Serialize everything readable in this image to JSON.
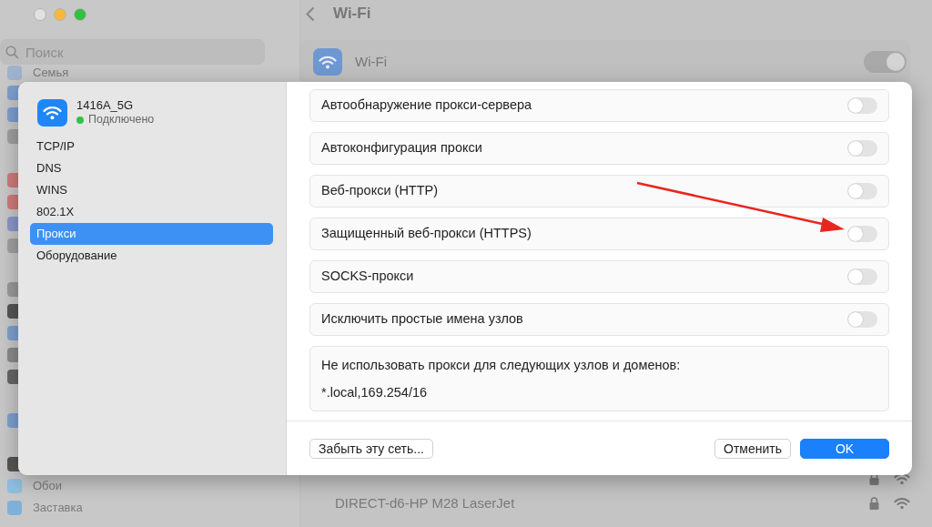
{
  "sidebar": {
    "search": {
      "placeholder": "Поиск"
    },
    "items": [
      {
        "label": "Семья"
      },
      {
        "label": "Обои"
      },
      {
        "label": "Заставка"
      }
    ]
  },
  "main": {
    "title": "Wi-Fi",
    "wifi": {
      "label": "Wi-Fi",
      "on": true
    },
    "networks": [
      {
        "name": "DIRECT-d6-HP M28 LaserJet",
        "locked": true
      }
    ]
  },
  "dialog": {
    "network": {
      "name": "1416A_5G",
      "status": "Подключено",
      "connected": true
    },
    "nav": [
      {
        "label": "TCP/IP",
        "selected": false
      },
      {
        "label": "DNS",
        "selected": false
      },
      {
        "label": "WINS",
        "selected": false
      },
      {
        "label": "802.1X",
        "selected": false
      },
      {
        "label": "Прокси",
        "selected": true
      },
      {
        "label": "Оборудование",
        "selected": false
      }
    ],
    "proxies": [
      {
        "label": "Автообнаружение прокси-сервера",
        "on": false
      },
      {
        "label": "Автоконфигурация прокси",
        "on": false
      },
      {
        "label": "Веб-прокси (HTTP)",
        "on": false
      },
      {
        "label": "Защищенный веб-прокси (HTTPS)",
        "on": false
      },
      {
        "label": "SOCKS-прокси",
        "on": false
      },
      {
        "label": "Исключить простые имена узлов",
        "on": false
      }
    ],
    "exceptions": {
      "label": "Не использовать прокси для следующих узлов и доменов:",
      "value": "*.local,169.254/16"
    },
    "buttons": [
      {
        "label": "Забыть эту сеть...",
        "kind": "secondary"
      },
      {
        "label": "Отменить",
        "kind": "secondary"
      },
      {
        "label": "OK",
        "kind": "primary"
      }
    ]
  }
}
